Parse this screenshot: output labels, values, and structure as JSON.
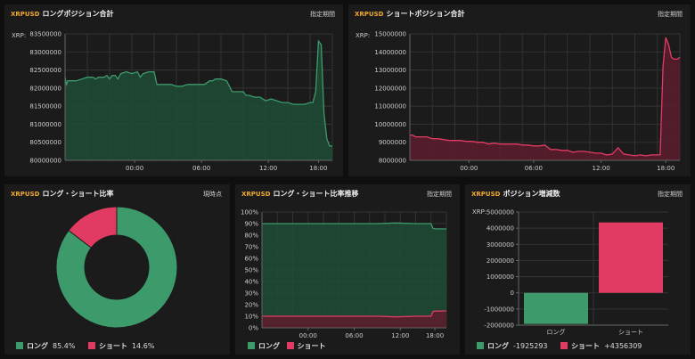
{
  "colors": {
    "long": "#3d9a6b",
    "long_fill": "#1f4a35",
    "short": "#e23b63",
    "short_fill": "#5a1d2c",
    "grid": "#333333",
    "axis": "#666666",
    "text": "#cccccc"
  },
  "panel1": {
    "symbol": "XRPUSD",
    "title": "ロングポジション合計",
    "right": "指定期間",
    "unit": "XRP:"
  },
  "panel2": {
    "symbol": "XRPUSD",
    "title": "ショートポジション合計",
    "right": "指定期間",
    "unit": "XRP:"
  },
  "panel3": {
    "symbol": "XRPUSD",
    "title": "ロング・ショート比率",
    "right": "現時点",
    "legend": {
      "long_name": "ロング",
      "long_val": "85.4%",
      "short_name": "ショート",
      "short_val": "14.6%"
    }
  },
  "panel4": {
    "symbol": "XRPUSD",
    "title": "ロング・ショート比率推移",
    "right": "指定期間",
    "legend": {
      "long_name": "ロング",
      "short_name": "ショート"
    }
  },
  "panel5": {
    "symbol": "XRPUSD",
    "title": "ポジション増減数",
    "right": "指定期間",
    "unit": "XRP:",
    "legend": {
      "long_name": "ロング",
      "long_val": "-1925293",
      "short_name": "ショート",
      "short_val": "+4356309"
    }
  },
  "chart_data": [
    {
      "type": "area",
      "title": "ロングポジション合計",
      "ylabel": "XRP:",
      "x_ticks": [
        "00:00",
        "06:00",
        "12:00",
        "18:00"
      ],
      "ylim": [
        80000000,
        83500000
      ],
      "y_ticks": [
        80000000,
        80500000,
        81000000,
        81500000,
        82000000,
        82500000,
        83000000,
        83500000
      ],
      "series": [
        {
          "name": "ロング",
          "x": [
            0,
            0.5,
            1,
            2,
            4,
            6,
            8,
            10,
            11,
            12,
            14,
            15,
            16,
            17,
            18,
            19,
            20,
            22,
            24,
            26,
            27,
            28,
            30,
            32,
            33,
            34,
            35,
            36,
            38,
            40,
            42,
            44,
            46,
            48,
            50,
            52,
            53,
            54,
            56,
            58,
            60,
            62,
            64,
            65,
            66,
            68,
            70,
            72,
            74,
            76,
            78,
            80,
            82,
            84,
            86,
            88,
            89,
            90,
            91,
            92,
            93,
            94,
            95,
            96
          ],
          "values": [
            82300000,
            82100000,
            82200000,
            82200000,
            82200000,
            82250000,
            82300000,
            82300000,
            82250000,
            82300000,
            82300000,
            82350000,
            82250000,
            82350000,
            82350000,
            82250000,
            82400000,
            82450000,
            82400000,
            82450000,
            82300000,
            82400000,
            82450000,
            82450000,
            82100000,
            82100000,
            82100000,
            82100000,
            82100000,
            82050000,
            82050000,
            82100000,
            82100000,
            82100000,
            82100000,
            82200000,
            82200000,
            82250000,
            82250000,
            82200000,
            81900000,
            81900000,
            81900000,
            81800000,
            81800000,
            81750000,
            81750000,
            81650000,
            81700000,
            81650000,
            81600000,
            81600000,
            81550000,
            81550000,
            81550000,
            81600000,
            81600000,
            81900000,
            83300000,
            83200000,
            81300000,
            80600000,
            80400000,
            80400000
          ]
        }
      ]
    },
    {
      "type": "area",
      "title": "ショートポジション合計",
      "ylabel": "XRP:",
      "x_ticks": [
        "00:00",
        "06:00",
        "12:00",
        "18:00"
      ],
      "ylim": [
        8000000,
        15000000
      ],
      "y_ticks": [
        8000000,
        9000000,
        10000000,
        11000000,
        12000000,
        13000000,
        14000000,
        15000000
      ],
      "series": [
        {
          "name": "ショート",
          "x": [
            0,
            1,
            2,
            4,
            6,
            8,
            10,
            12,
            14,
            16,
            18,
            20,
            22,
            24,
            26,
            28,
            30,
            32,
            34,
            36,
            38,
            40,
            42,
            44,
            46,
            48,
            50,
            52,
            54,
            56,
            58,
            60,
            62,
            64,
            66,
            68,
            70,
            72,
            74,
            76,
            78,
            80,
            82,
            84,
            86,
            88,
            89,
            90,
            91,
            92,
            93,
            94,
            95,
            96
          ],
          "values": [
            9400000,
            9400000,
            9300000,
            9300000,
            9300000,
            9200000,
            9200000,
            9150000,
            9100000,
            9100000,
            9100000,
            9050000,
            9050000,
            9000000,
            9000000,
            8900000,
            8950000,
            8900000,
            8900000,
            8900000,
            8900000,
            8850000,
            8850000,
            8800000,
            8800000,
            8850000,
            8600000,
            8600000,
            8550000,
            8550000,
            8450000,
            8500000,
            8500000,
            8450000,
            8400000,
            8400000,
            8300000,
            8350000,
            8700000,
            8350000,
            8300000,
            8250000,
            8300000,
            8250000,
            8300000,
            8300000,
            8300000,
            13200000,
            14800000,
            14400000,
            13700000,
            13600000,
            13600000,
            13700000
          ]
        }
      ]
    },
    {
      "type": "pie",
      "title": "ロング・ショート比率",
      "categories": [
        "ロング",
        "ショート"
      ],
      "values": [
        85.4,
        14.6
      ]
    },
    {
      "type": "area",
      "title": "ロング・ショート比率推移",
      "x_ticks": [
        "00:00",
        "06:00",
        "12:00",
        "18:00"
      ],
      "ylim": [
        0,
        100
      ],
      "y_ticks": [
        0,
        10,
        20,
        30,
        40,
        50,
        60,
        70,
        80,
        90,
        100
      ],
      "series": [
        {
          "name": "ロング",
          "x": [
            0,
            10,
            20,
            30,
            40,
            50,
            60,
            70,
            80,
            85,
            88,
            89,
            90,
            92,
            96
          ],
          "values": [
            90,
            90,
            90,
            90,
            90,
            90,
            90,
            90.5,
            90,
            90,
            90,
            86,
            85.5,
            85.5,
            85.4
          ]
        },
        {
          "name": "ショート",
          "x": [
            0,
            10,
            20,
            30,
            40,
            50,
            60,
            70,
            80,
            85,
            88,
            89,
            90,
            92,
            96
          ],
          "values": [
            10,
            10,
            10,
            10,
            10,
            10,
            10,
            9.5,
            10,
            10,
            10,
            14,
            14.5,
            14.5,
            14.6
          ]
        }
      ]
    },
    {
      "type": "bar",
      "title": "ポジション増減数",
      "ylabel": "XRP:",
      "categories": [
        "ロング",
        "ショート"
      ],
      "values": [
        -1925293,
        4356309
      ],
      "ylim": [
        -2000000,
        5000000
      ],
      "y_ticks": [
        -2000000,
        -1000000,
        0,
        1000000,
        2000000,
        3000000,
        4000000,
        5000000
      ]
    }
  ]
}
